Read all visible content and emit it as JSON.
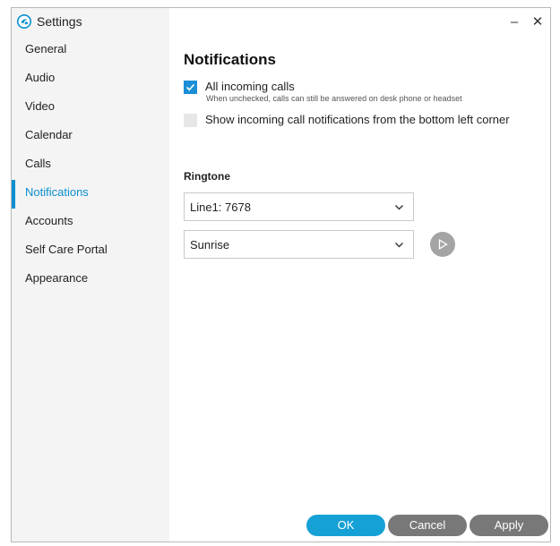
{
  "window": {
    "title": "Settings",
    "minimize_glyph": "–",
    "close_glyph": "✕"
  },
  "sidebar": {
    "items": [
      {
        "label": "General",
        "active": false
      },
      {
        "label": "Audio",
        "active": false
      },
      {
        "label": "Video",
        "active": false
      },
      {
        "label": "Calendar",
        "active": false
      },
      {
        "label": "Calls",
        "active": false
      },
      {
        "label": "Notifications",
        "active": true
      },
      {
        "label": "Accounts",
        "active": false
      },
      {
        "label": "Self Care Portal",
        "active": false
      },
      {
        "label": "Appearance",
        "active": false
      }
    ]
  },
  "notifications": {
    "heading": "Notifications",
    "all_incoming": {
      "label": "All incoming calls",
      "sublabel": "When unchecked, calls can still be answered on desk phone or headset",
      "checked": true
    },
    "bottom_left": {
      "label": "Show incoming call notifications from the bottom left corner",
      "checked": false
    },
    "ringtone": {
      "label": "Ringtone",
      "line_value": "Line1: 7678",
      "tone_value": "Sunrise"
    }
  },
  "footer": {
    "ok_label": "OK",
    "cancel_label": "Cancel",
    "apply_label": "Apply"
  },
  "colors": {
    "accent": "#0a8fd0",
    "ok_button": "#16a1d6",
    "secondary_button": "#787878",
    "sidebar_bg": "#f4f4f4"
  },
  "icons": {
    "app": "app-logo-icon",
    "check": "checkmark-icon",
    "dropdown": "chevron-down-icon",
    "play": "play-icon"
  }
}
